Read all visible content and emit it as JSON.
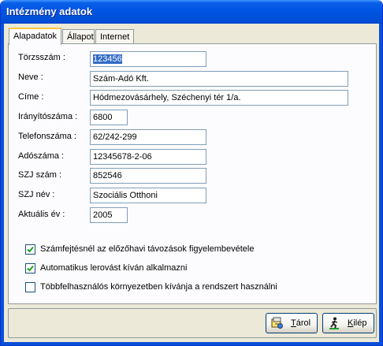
{
  "window": {
    "title": "Intézmény adatok"
  },
  "tabs": [
    {
      "label": "Alapadatok",
      "active": true
    },
    {
      "label": "Állapot",
      "active": false
    },
    {
      "label": "Internet",
      "active": false
    }
  ],
  "fields": {
    "torzsszam": {
      "label": "Törzsszám :",
      "value": "123456"
    },
    "neve": {
      "label": "Neve :",
      "value": "Szám-Adó Kft."
    },
    "cime": {
      "label": "Címe :",
      "value": "Hódmezovásárhely, Széchenyi tér 1/a."
    },
    "iranyitoszama": {
      "label": "Irányítószáma :",
      "value": "6800"
    },
    "telefonszama": {
      "label": "Telefonszáma :",
      "value": "62/242-299"
    },
    "adoszama": {
      "label": "Adószáma :",
      "value": "12345678-2-06"
    },
    "szj_szam": {
      "label": "SZJ szám :",
      "value": "852546"
    },
    "szj_nev": {
      "label": "SZJ név :",
      "value": "Szociális Otthoni"
    },
    "aktualis_ev": {
      "label": "Aktuális év :",
      "value": "2005"
    }
  },
  "checkboxes": [
    {
      "label": "Számfejtésnél az előzőhavi távozások figyelembevétele",
      "checked": true
    },
    {
      "label": "Automatikus lerovást kíván alkalmazni",
      "checked": true
    },
    {
      "label": "Többfelhasználós környezetben kívánja a rendszert használni",
      "checked": false
    }
  ],
  "buttons": {
    "save": {
      "mnemonic": "T",
      "rest": "árol",
      "icon": "save-icon"
    },
    "exit": {
      "mnemonic": "K",
      "rest": "ilép",
      "icon": "exit-icon"
    }
  },
  "colors": {
    "titlebar": "#0054e3",
    "tab_highlight": "#ffc73c",
    "selection": "#316ac5",
    "checkmark": "#21a121"
  }
}
